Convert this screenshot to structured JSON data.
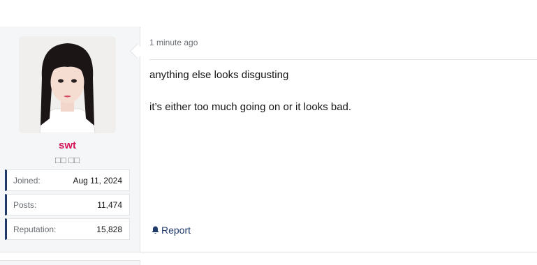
{
  "post": {
    "timestamp": "1 minute ago",
    "paragraphs": [
      "anything else looks disgusting",
      "it’s either too much going on or it looks bad."
    ],
    "report_label": "Report"
  },
  "user": {
    "name": "swt",
    "title": "□□ □□",
    "stats": [
      {
        "label": "Joined:",
        "value": "Aug 11, 2024"
      },
      {
        "label": "Posts:",
        "value": "11,474"
      },
      {
        "label": "Reputation:",
        "value": "15,828"
      }
    ]
  },
  "colors": {
    "username": "#d4145a",
    "accent": "#1f3a6b"
  },
  "icons": {
    "report": "bell-icon"
  }
}
